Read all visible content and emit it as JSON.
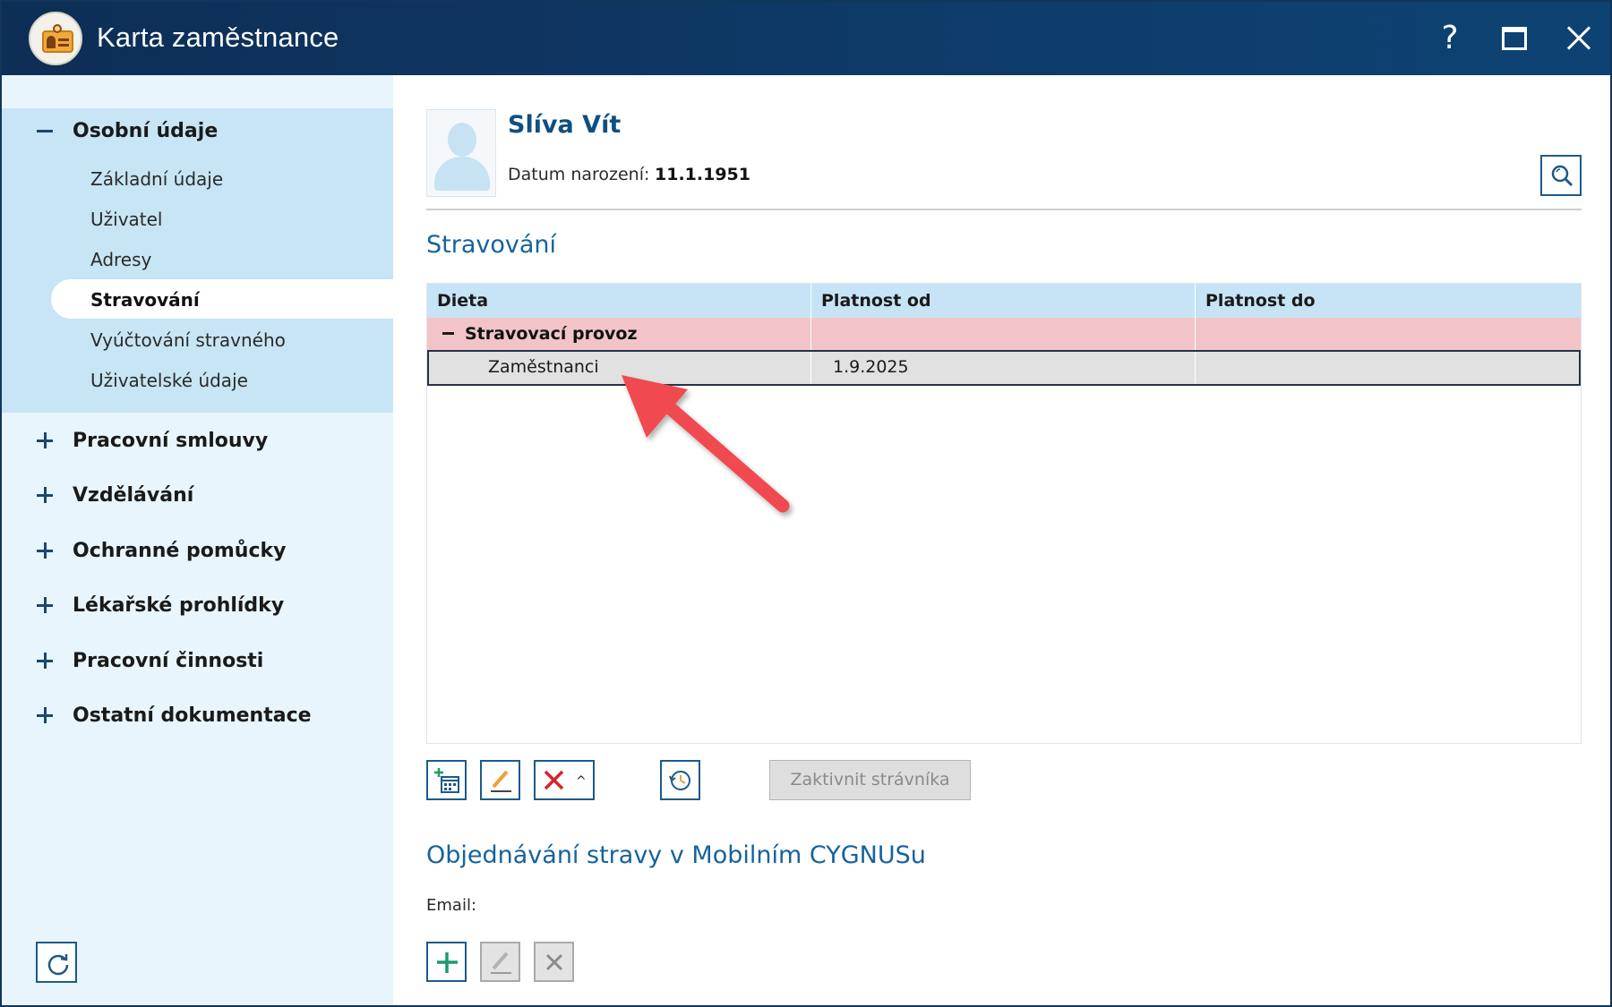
{
  "window": {
    "title": "Karta zaměstnance",
    "help_glyph": "?",
    "icons": [
      "app-card-icon",
      "help-icon",
      "maximize-icon",
      "close-icon"
    ]
  },
  "sidebar": {
    "open_group": {
      "label": "Osobní údaje",
      "items": [
        {
          "label": "Základní údaje",
          "active": false
        },
        {
          "label": "Uživatel",
          "active": false
        },
        {
          "label": "Adresy",
          "active": false
        },
        {
          "label": "Stravování",
          "active": true
        },
        {
          "label": "Vyúčtování stravného",
          "active": false
        },
        {
          "label": "Uživatelské údaje",
          "active": false
        }
      ]
    },
    "collapsed_groups": [
      {
        "label": "Pracovní smlouvy"
      },
      {
        "label": "Vzdělávání"
      },
      {
        "label": "Ochranné pomůcky"
      },
      {
        "label": "Lékařské prohlídky"
      },
      {
        "label": "Pracovní činnosti"
      },
      {
        "label": "Ostatní dokumentace"
      }
    ],
    "refresh_icon": "refresh-icon"
  },
  "employee": {
    "name": "Slíva Vít",
    "dob_label": "Datum narození:",
    "dob_value": "11.1.1951",
    "avatar_icon": "person-placeholder-icon",
    "search_icon": "search-icon"
  },
  "meals_section": {
    "title": "Stravování",
    "grid": {
      "columns": [
        "Dieta",
        "Platnost od",
        "Platnost do"
      ],
      "group": {
        "label": "Stravovací provoz",
        "expanded": true
      },
      "rows": [
        {
          "dieta": "Zaměstnanci",
          "platnost_od": "1.9.2025",
          "platnost_do": ""
        }
      ]
    },
    "toolbar": {
      "add_icon": "add-calendar-icon",
      "edit_icon": "edit-pencil-icon",
      "delete_icon": "delete-x-icon",
      "history_icon": "history-clock-icon",
      "activate_label": "Zaktivnit strávníka"
    }
  },
  "mobile_section": {
    "title": "Objednávání stravy v Mobilním CYGNUSu",
    "email_label": "Email:",
    "toolbar": {
      "add_icon": "plus-icon",
      "edit_icon": "edit-pencil-icon",
      "delete_icon": "delete-x-icon"
    }
  },
  "colors": {
    "titlebar": "#0d2e55",
    "sidebar_bg": "#e8f5fc",
    "sidebar_open_group": "#c7e5f5",
    "grid_header": "#c6e4f5",
    "group_row": "#f2c4c8",
    "selected_row": "#e1e1e1",
    "accent_text": "#17639c",
    "annotation_arrow": "#f04a4f"
  }
}
